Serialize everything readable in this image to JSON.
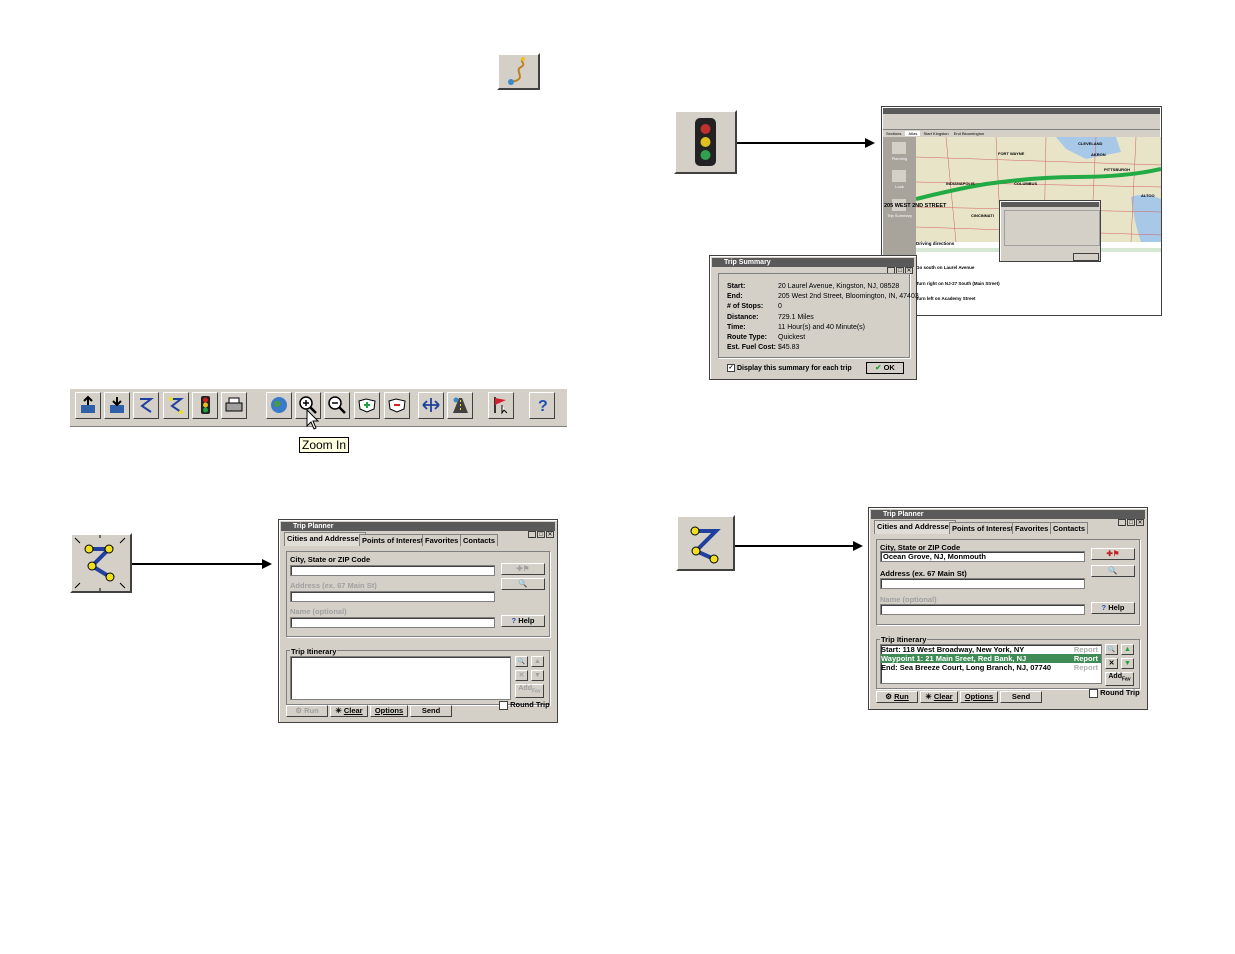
{
  "toolbar": {
    "tooltip": "Zoom In",
    "buttons": [
      {
        "name": "import-icon"
      },
      {
        "name": "export-icon"
      },
      {
        "name": "route-icon"
      },
      {
        "name": "trip-planner-icon"
      },
      {
        "name": "traffic-light-icon"
      },
      {
        "name": "print-icon"
      },
      {
        "name": "globe-icon"
      },
      {
        "name": "zoom-in-icon"
      },
      {
        "name": "zoom-out-icon"
      },
      {
        "name": "zoom-region-in-icon"
      },
      {
        "name": "zoom-region-out-icon"
      },
      {
        "name": "pan-icon"
      },
      {
        "name": "road-icon"
      },
      {
        "name": "flag-icon"
      },
      {
        "name": "help-icon"
      }
    ]
  },
  "left_planner": {
    "title": "Trip Planner",
    "tabs": [
      "Cities and Addresses",
      "Points of Interest",
      "Favorites",
      "Contacts"
    ],
    "city_label": "City, State or ZIP Code",
    "city_value": "",
    "address_label": "Address (ex. 67 Main St)",
    "name_label": "Name (optional)",
    "help_label": "Help",
    "itinerary_label": "Trip Itinerary",
    "add_label": "Add",
    "fav_label": "Fav",
    "run_label": "Run",
    "clear_label": "Clear",
    "options_label": "Options",
    "send_label": "Send",
    "round_trip_label": "Round Trip"
  },
  "right_planner": {
    "title": "Trip Planner",
    "tabs": [
      "Cities and Addresses",
      "Points of Interest",
      "Favorites",
      "Contacts"
    ],
    "city_label": "City, State or ZIP Code",
    "city_value": "Ocean Grove, NJ, Monmouth",
    "address_label": "Address (ex. 67 Main St)",
    "name_label": "Name (optional)",
    "help_label": "Help",
    "itinerary_label": "Trip Itinerary",
    "itinerary": [
      {
        "text": "Start: 118 West Broadway, New York, NY",
        "report": "Report"
      },
      {
        "text": "Waypoint 1: 21 Main Sreet, Red Bank, NJ",
        "report": "Report"
      },
      {
        "text": "End: Sea Breeze Court, Long Branch, NJ, 07740",
        "report": "Report"
      }
    ],
    "add_label": "Add",
    "fav_label": "Fav",
    "run_label": "Run",
    "clear_label": "Clear",
    "options_label": "Options",
    "send_label": "Send",
    "round_trip_label": "Round Trip"
  },
  "trip_summary": {
    "title": "Trip Summary",
    "rows": [
      {
        "label": "Start:",
        "value": "20 Laurel Avenue, Kingston, NJ, 08528"
      },
      {
        "label": "End:",
        "value": "205 West 2nd Street, Bloomington, IN, 47403"
      },
      {
        "label": "# of Stops:",
        "value": "0"
      },
      {
        "label": "Distance:",
        "value": "729.1 Miles"
      },
      {
        "label": "Time:",
        "value": "11 Hour(s) and 40 Minute(s)"
      },
      {
        "label": "Route Type:",
        "value": "Quickest"
      },
      {
        "label": "Est. Fuel Cost:",
        "value": "$45.83"
      }
    ],
    "checkbox_label": "Display this summary for each trip",
    "ok_label": "OK"
  },
  "map_window": {
    "tabs": [
      "Sections",
      "Atlas",
      "Start Kingston",
      "End Bloomington"
    ],
    "sidebar_items": [
      "Planning",
      "Lock",
      "Trip Summary"
    ],
    "destination_label": "205 WEST 2ND STREET",
    "driving_directions_label": "Driving directions",
    "cities": [
      "CLEVELAND",
      "FORT WAYNE",
      "AKRON",
      "INDIANAPOLIS",
      "COLUMBUS",
      "PITTSBURGH",
      "CINCINNATI",
      "ALTOO"
    ],
    "directions": [
      "Go south on Laurel Avenue",
      "Turn right on NJ-27 South (Main Street)",
      "Turn left on Academy Street"
    ]
  },
  "colors": {
    "window_face": "#d4d0c8",
    "title_bar": "#5a5a5a",
    "route_green": "#22aa44",
    "selection_green": "#3f8a55"
  }
}
